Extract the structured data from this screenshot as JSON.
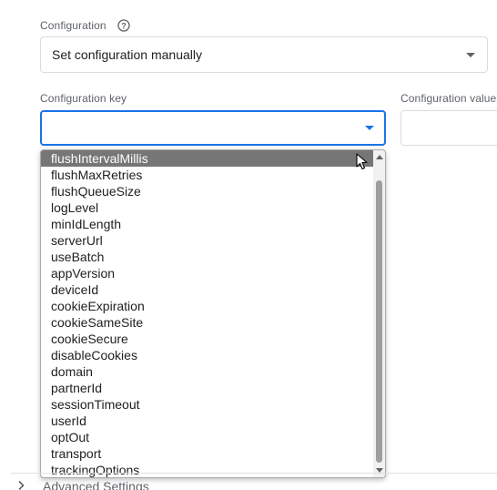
{
  "configuration": {
    "label": "Configuration",
    "selected": "Set configuration manually"
  },
  "key_field": {
    "label": "Configuration key",
    "value": ""
  },
  "value_field": {
    "label": "Configuration value",
    "value": ""
  },
  "dropdown": {
    "highlighted": "flushIntervalMillis",
    "options": [
      "flushIntervalMillis",
      "flushMaxRetries",
      "flushQueueSize",
      "logLevel",
      "minIdLength",
      "serverUrl",
      "useBatch",
      "appVersion",
      "deviceId",
      "cookieExpiration",
      "cookieSameSite",
      "cookieSecure",
      "disableCookies",
      "domain",
      "partnerId",
      "sessionTimeout",
      "userId",
      "optOut",
      "transport",
      "trackingOptions"
    ]
  },
  "advanced": {
    "label": "Advanced Settings"
  },
  "icons": {
    "help": "help-circle-icon",
    "dropdown_caret": "chevron-down-icon",
    "expand": "chevron-right-icon",
    "cursor": "mouse-pointer-icon"
  },
  "colors": {
    "focus_border": "#1a73e8",
    "highlight_bg": "#767676",
    "label_text": "#5f6368"
  }
}
